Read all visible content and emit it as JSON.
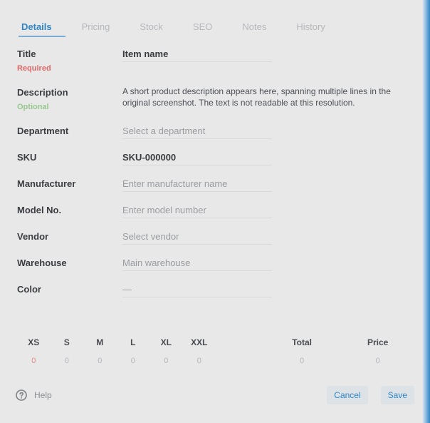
{
  "tabs": [
    {
      "label": "Details",
      "active": true
    },
    {
      "label": "Pricing",
      "active": false
    },
    {
      "label": "Stock",
      "active": false
    },
    {
      "label": "SEO",
      "active": false
    },
    {
      "label": "Notes",
      "active": false
    },
    {
      "label": "History",
      "active": false
    }
  ],
  "fields": {
    "title": {
      "label": "Title",
      "sublabel": "Required",
      "value": "Item name"
    },
    "description": {
      "label": "Description",
      "sublabel": "Optional",
      "value": "A short product description appears here, spanning multiple lines in the original screenshot. The text is not readable at this resolution."
    },
    "department": {
      "label": "Department",
      "value": "Select a department"
    },
    "sku": {
      "label": "SKU",
      "value": "SKU-000000"
    },
    "manufacturer": {
      "label": "Manufacturer",
      "value": "Enter manufacturer name"
    },
    "modelnum": {
      "label": "Model No.",
      "value": "Enter model number"
    },
    "vendor": {
      "label": "Vendor",
      "value": "Select vendor"
    },
    "warehouse": {
      "label": "Warehouse",
      "value": "Main warehouse"
    },
    "color": {
      "label": "Color",
      "value": "—"
    }
  },
  "sizes": {
    "headers": [
      "XS",
      "S",
      "M",
      "L",
      "XL",
      "XXL"
    ],
    "values": [
      "0",
      "0",
      "0",
      "0",
      "0",
      "0"
    ],
    "extra_headers": [
      "Total",
      "Price"
    ],
    "extra_values": [
      "0",
      "0"
    ]
  },
  "footer": {
    "left_label": "Help",
    "cancel": "Cancel",
    "save": "Save"
  },
  "icons": {
    "help": "help-icon"
  }
}
